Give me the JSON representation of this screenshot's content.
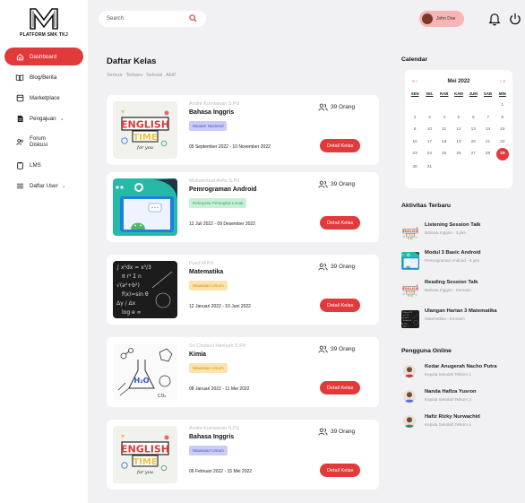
{
  "brand": {
    "name": "PLATFORM SMK TKJ"
  },
  "sidebar": {
    "items": [
      {
        "label": "Dashboard",
        "icon": "home-icon",
        "active": true
      },
      {
        "label": "Blog/Berita",
        "icon": "book-icon"
      },
      {
        "label": "Marketplace",
        "icon": "store-icon"
      },
      {
        "label": "Pengajuan",
        "icon": "document-icon",
        "has_dropdown": true
      },
      {
        "label": "Forum Diskusi",
        "icon": "users-icon"
      },
      {
        "label": "LMS",
        "icon": "clipboard-icon"
      },
      {
        "label": "Daftar User",
        "icon": "list-icon",
        "has_dropdown": true
      }
    ]
  },
  "header": {
    "search_placeholder": "Search",
    "user_name": "John Doe"
  },
  "main": {
    "title": "Daftar Kelas",
    "filters": [
      "Semua",
      "Terbaru",
      "Selesai",
      "Aktif"
    ],
    "classes": [
      {
        "teacher": "Andre Kurniawan S.Pd",
        "subject": "Bahasa Inggris",
        "tag": "Muatan Nasional",
        "tag_style": "blue",
        "dates": "05 September 2022 - 10 November 2022",
        "count": "39 Orang",
        "button": "Detail Kelas",
        "thumb": "english"
      },
      {
        "teacher": "Muhammad Arifin S.Pd",
        "subject": "Pemrograman Android",
        "tag": "Rekayasa Perangkat Lunak",
        "tag_style": "green",
        "dates": "12 Juli 2022 - 09 Desember 2022",
        "count": "39 Orang",
        "button": "Detail Kelas",
        "thumb": "android"
      },
      {
        "teacher": "Fuad M.Pd",
        "subject": "Matematika",
        "tag": "Wawasan Umum",
        "tag_style": "yellow",
        "dates": "12 Januari 2022 - 10 Juni 2022",
        "count": "39 Orang",
        "button": "Detail Kelas",
        "thumb": "math"
      },
      {
        "teacher": "Sri Cholsiul Haniyah S.Pd",
        "subject": "Kimia",
        "tag": "Wawasan Umum",
        "tag_style": "yellow",
        "dates": "08 Januari 2022 - 11 Mei 2022",
        "count": "39 Orang",
        "button": "Detail Kelas",
        "thumb": "chemistry"
      },
      {
        "teacher": "Andre Kurniawan S.Pd",
        "subject": "Bahasa Inggris",
        "tag": "Wawasan Umum",
        "tag_style": "blue",
        "dates": "06 Februari 2022 - 15 Mei 2022",
        "count": "39 Orang",
        "button": "Detail Kelas",
        "thumb": "english"
      }
    ]
  },
  "calendar": {
    "title": "Calendar",
    "month": "Mei 2022",
    "prev": "«  ‹",
    "next": "›  »",
    "weekdays": [
      "SEN",
      "SEL",
      "RAB",
      "KAM",
      "JUM",
      "SAB",
      "MIN"
    ],
    "leading_blanks": 6,
    "days": 31,
    "today": 29
  },
  "activities": {
    "title": "Aktivitas Terbaru",
    "items": [
      {
        "title": "Listening Session Talk",
        "sub": "Bahasa Inggris - 3 jam",
        "thumb": "english"
      },
      {
        "title": "Modul 3 Basic Android",
        "sub": "Pemrograman Android - 8 jam",
        "thumb": "android"
      },
      {
        "title": "Reading Session Talk",
        "sub": "Bahasa Inggris - Kemarin",
        "thumb": "english"
      },
      {
        "title": "Ulangan Harian 3 Matematika",
        "sub": "Matematika - Kemarin",
        "thumb": "math"
      }
    ]
  },
  "online": {
    "title": "Pengguna Online",
    "users": [
      {
        "name": "Kedar Anugerah Nacho Putra",
        "role": "Kepala Sekolah Telkom 1"
      },
      {
        "name": "Nanda Hafiza Yusron",
        "role": "Kepala Sekolah Telkom 3"
      },
      {
        "name": "Hafiz Rizky Nurwachid",
        "role": "Kepala Sekolah Telkom 4"
      }
    ]
  },
  "colors": {
    "accent": "#e23a3a",
    "background": "#f1f1f3"
  }
}
